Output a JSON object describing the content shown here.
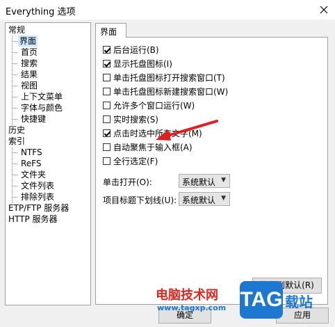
{
  "window": {
    "title": "Everything 选项"
  },
  "sidebar": {
    "items": [
      {
        "label": "常规"
      },
      {
        "label": "界面"
      },
      {
        "label": "首页"
      },
      {
        "label": "搜索"
      },
      {
        "label": "结果"
      },
      {
        "label": "视图"
      },
      {
        "label": "上下文菜单"
      },
      {
        "label": "字体与颜色"
      },
      {
        "label": "快捷键"
      },
      {
        "label": "历史"
      },
      {
        "label": "索引"
      },
      {
        "label": "NTFS"
      },
      {
        "label": "ReFS"
      },
      {
        "label": "文件夹"
      },
      {
        "label": "文件列表"
      },
      {
        "label": "排除列表"
      },
      {
        "label": "ETP/FTP 服务器"
      },
      {
        "label": "HTTP 服务器"
      }
    ]
  },
  "tab": {
    "label": "界面"
  },
  "options": [
    {
      "label": "后台运行(B)",
      "checked": true
    },
    {
      "label": "显示托盘图标(I)",
      "checked": true
    },
    {
      "label": "单击托盘图标打开搜索窗口(T)",
      "checked": false
    },
    {
      "label": "单击托盘图标新建搜索窗口(W)",
      "checked": false
    },
    {
      "label": "允许多个窗口运行(W)",
      "checked": false
    },
    {
      "label": "实时搜索(S)",
      "checked": false
    },
    {
      "label": "点击时选中所有文字(M)",
      "checked": true
    },
    {
      "label": "自动聚焦于输入框(A)",
      "checked": false
    },
    {
      "label": "全行选定(F)",
      "checked": false
    }
  ],
  "combos": [
    {
      "label": "单击打开(O):",
      "value": "系统默认"
    },
    {
      "label": "项目标题下划线(U):",
      "value": "系统默认"
    }
  ],
  "buttons": {
    "restore": "恢复到默认(R)",
    "ok": "确定",
    "apply": "应用"
  },
  "watermark": {
    "site_name": "电脑技术网",
    "url": "www.tagxp.com",
    "logo": "TAG",
    "logo_suffix": "载站"
  },
  "colors": {
    "annotation_arrow": "#e02020",
    "tree_selection": "#cce8ff",
    "watermark_red": "#e0281e",
    "watermark_blue": "#1e78d2"
  }
}
